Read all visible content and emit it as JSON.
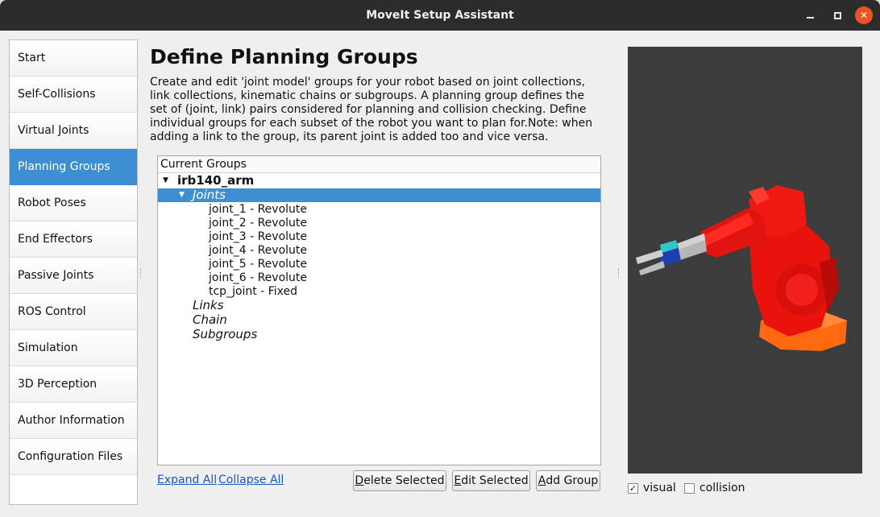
{
  "window": {
    "title": "MoveIt Setup Assistant"
  },
  "sidebar": {
    "items": [
      {
        "label": "Start",
        "active": false
      },
      {
        "label": "Self-Collisions",
        "active": false
      },
      {
        "label": "Virtual Joints",
        "active": false
      },
      {
        "label": "Planning Groups",
        "active": true
      },
      {
        "label": "Robot Poses",
        "active": false
      },
      {
        "label": "End Effectors",
        "active": false
      },
      {
        "label": "Passive Joints",
        "active": false
      },
      {
        "label": "ROS Control",
        "active": false
      },
      {
        "label": "Simulation",
        "active": false
      },
      {
        "label": "3D Perception",
        "active": false
      },
      {
        "label": "Author Information",
        "active": false
      },
      {
        "label": "Configuration Files",
        "active": false
      }
    ]
  },
  "main": {
    "title": "Define Planning Groups",
    "description": "Create and edit 'joint model' groups for your robot based on joint collections, link collections, kinematic chains or subgroups. A planning group defines the set of (joint, link) pairs considered for planning and collision checking. Define individual groups for each subset of the robot you want to plan for.Note: when adding a link to the group, its parent joint is added too and vice versa.",
    "tree": {
      "header": "Current Groups",
      "group": "irb140_arm",
      "joints_label": "Joints",
      "joints": [
        "joint_1 - Revolute",
        "joint_2 - Revolute",
        "joint_3 - Revolute",
        "joint_4 - Revolute",
        "joint_5 - Revolute",
        "joint_6 - Revolute",
        "tcp_joint - Fixed"
      ],
      "links_label": "Links",
      "chain_label": "Chain",
      "subgroups_label": "Subgroups"
    },
    "expand_all": "Expand All",
    "collapse_all": "Collapse All",
    "buttons": {
      "delete": {
        "mnemonic": "D",
        "rest": "elete Selected"
      },
      "edit": {
        "mnemonic": "E",
        "rest": "dit Selected"
      },
      "add": {
        "mnemonic": "A",
        "rest": "dd Group"
      }
    }
  },
  "viewer": {
    "visual_label": "visual",
    "visual_checked": true,
    "collision_label": "collision",
    "collision_checked": false
  },
  "colors": {
    "accent": "#3d8fd1",
    "titlebar": "#2c2c2c",
    "close": "#e95420",
    "robot": "#e8130d",
    "robot_base": "#ff6a10",
    "viewport": "#3c3c3c"
  }
}
